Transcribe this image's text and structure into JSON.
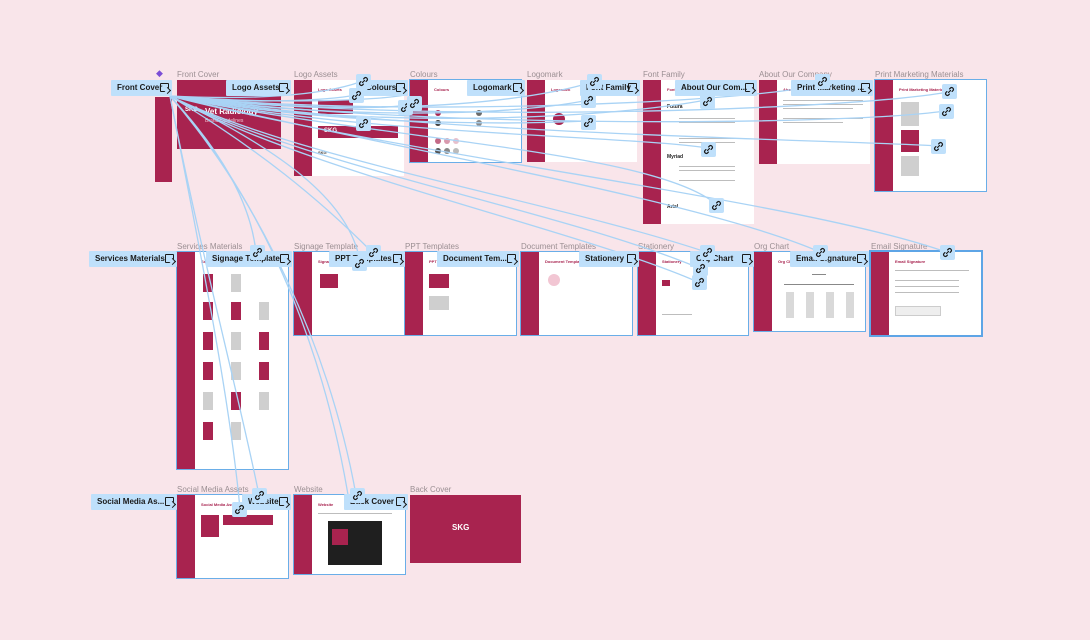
{
  "canvas": {
    "background": "#f9e5ea",
    "brand_color": "#a8234f",
    "selection_color": "#bfe0fb"
  },
  "frames": [
    {
      "id": "front-cover",
      "title": "Front Cover",
      "cover_title": "Vet Radiology",
      "cover_sub": "Brand Guidelines",
      "logo_text": "SKG"
    },
    {
      "id": "logo-assets",
      "title": "Logo Assets",
      "heading": "Logo Assets",
      "logo_text": "SKG"
    },
    {
      "id": "colours",
      "title": "Colours",
      "heading": "Colours"
    },
    {
      "id": "logomark",
      "title": "Logomark",
      "heading": "Logomark"
    },
    {
      "id": "font-family",
      "title": "Font Family",
      "heading": "Font Family",
      "sample1": "Futura",
      "sample2": "Arial",
      "sample3": "Myriad"
    },
    {
      "id": "about-our-company",
      "title": "About Our Company",
      "heading": "About Our Company"
    },
    {
      "id": "print-marketing-materials",
      "title": "Print Marketing Materials",
      "heading": "Print Marketing Materials"
    },
    {
      "id": "services-materials",
      "title": "Services Materials",
      "heading": "Services Materials"
    },
    {
      "id": "signage-template",
      "title": "Signage Template",
      "heading": "Signage Template"
    },
    {
      "id": "ppt-templates",
      "title": "PPT Templates",
      "heading": "PPT Templates"
    },
    {
      "id": "document-templates",
      "title": "Document Templates",
      "heading": "Document Templates"
    },
    {
      "id": "stationery",
      "title": "Stationery",
      "heading": "Stationery"
    },
    {
      "id": "org-chart",
      "title": "Org Chart",
      "heading": "Org Chart"
    },
    {
      "id": "email-signature",
      "title": "Email Signature",
      "heading": "Email Signature"
    },
    {
      "id": "social-media-assets",
      "title": "Social Media Assets",
      "heading": "Social Media Assets"
    },
    {
      "id": "website",
      "title": "Website",
      "heading": "Website"
    },
    {
      "id": "back-cover",
      "title": "Back Cover",
      "logo_text": "SKG"
    }
  ],
  "proto_labels": {
    "front_cover": "Front Cover",
    "logo_assets": "Logo Assets",
    "colours": "Colours",
    "logomark": "Logomark",
    "font_family": "Font Family",
    "about_our_company": "About Our Com...",
    "print_marketing": "Print Marketing ...",
    "services_materials": "Services Materials",
    "signage_template": "Signage Template",
    "ppt_templates": "PPT Templates",
    "document_templates": "Document Tem...",
    "stationery": "Stationery",
    "org_chart": "Org Chart",
    "email_signature": "Email Signature",
    "social_media_assets": "Social Media As...",
    "website": "Website",
    "back_cover": "Back Cover"
  },
  "icons": {
    "link": "link-icon",
    "frame": "frame-icon",
    "flow_start": "flow-start-icon"
  }
}
